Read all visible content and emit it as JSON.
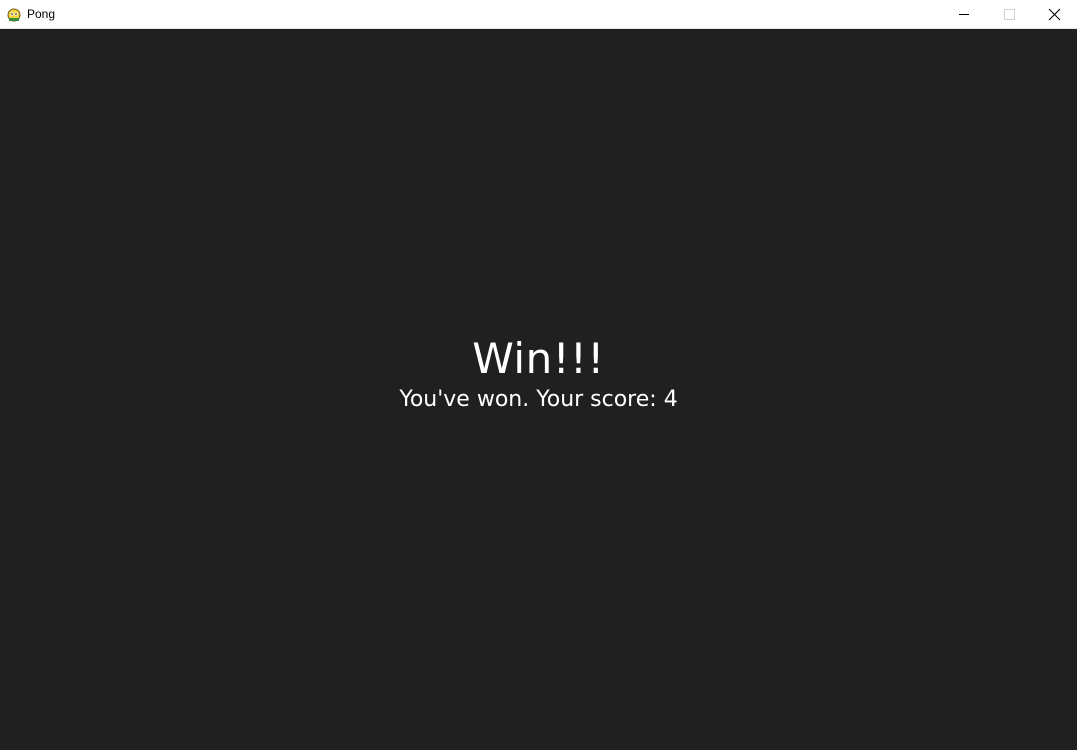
{
  "window": {
    "title": "Pong",
    "app_icon": "pygame-snake-icon",
    "controls": {
      "minimize_icon": "minimize-icon",
      "maximize_icon": "maximize-icon",
      "close_icon": "close-icon"
    }
  },
  "game": {
    "background_color": "#202020",
    "text_color": "#ffffff",
    "result_title": "Win!!!",
    "result_message": "You've won. Your score: 4"
  }
}
